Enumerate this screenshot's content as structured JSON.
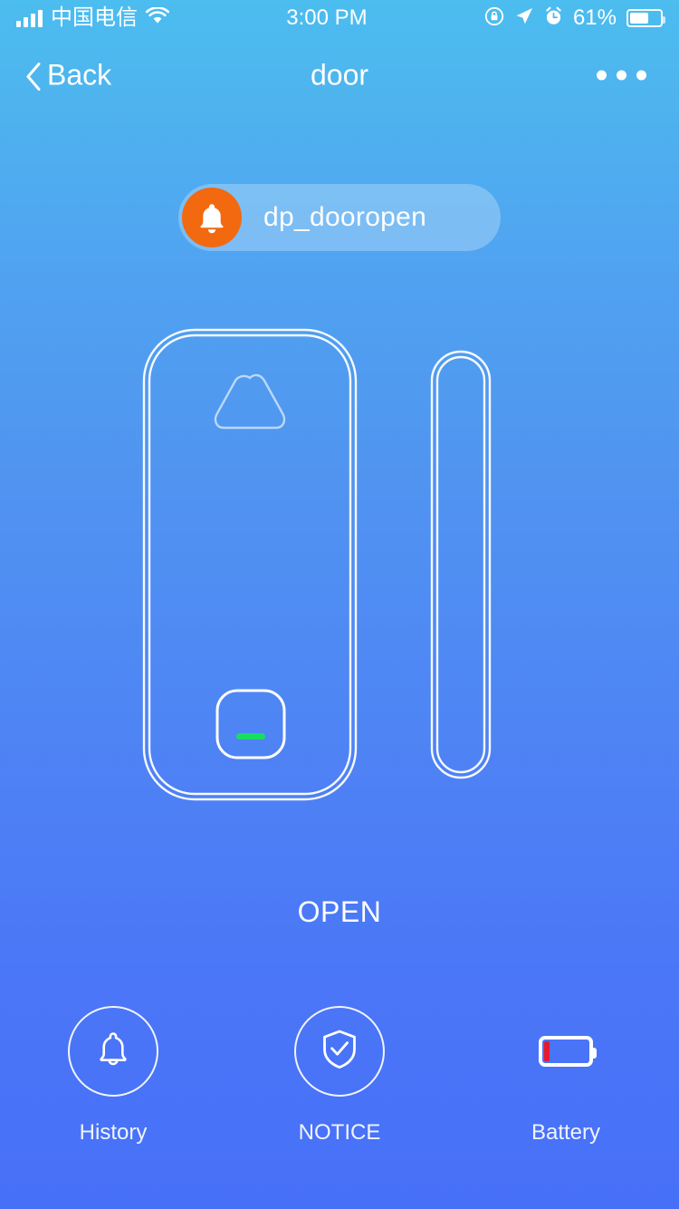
{
  "status_bar": {
    "carrier": "中国电信",
    "signal_icon": "signal-bars-icon",
    "wifi_icon": "wifi-icon",
    "time": "3:00 PM",
    "rotation_lock_icon": "rotation-lock-icon",
    "location_icon": "location-arrow-icon",
    "alarm_icon": "alarm-clock-icon",
    "battery_percent": "61%",
    "battery_level": 61,
    "battery_icon": "battery-icon"
  },
  "nav": {
    "back_label": "Back",
    "back_icon": "chevron-left-icon",
    "title": "door",
    "more_icon": "more-dots-icon"
  },
  "alert": {
    "icon": "bell-icon",
    "label": "dp_dooropen",
    "icon_color": "#F2690F",
    "pill_background": "rgba(255,255,255,0.26)"
  },
  "device": {
    "illustration": "door-contact-sensor-illustration",
    "sensor_body": "sensor-body-outline",
    "vent_icon": "rounded-triangle-icon",
    "button_icon": "sensor-button-outline",
    "led_icon": "green-led-indicator",
    "led_color": "#18DE5E",
    "magnet_strip": "magnet-strip-outline"
  },
  "state": {
    "label": "OPEN"
  },
  "actions": [
    {
      "id": "history",
      "label": "History",
      "icon": "bell-outline-icon",
      "style": "circle"
    },
    {
      "id": "notice",
      "label": "NOTICE",
      "icon": "shield-check-icon",
      "style": "circle"
    },
    {
      "id": "battery",
      "label": "Battery",
      "icon": "battery-low-icon",
      "style": "plain",
      "level_color": "#E8192B",
      "level_percent": 12
    }
  ],
  "theme": {
    "gradient_top": "#4CBDEF",
    "gradient_bottom": "#4770F8",
    "accent_orange": "#F2690F",
    "led_green": "#18DE5E",
    "battery_red": "#E8192B"
  }
}
